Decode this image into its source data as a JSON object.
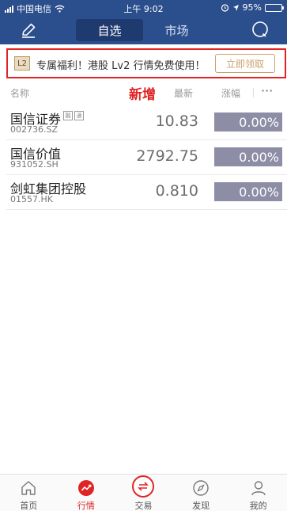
{
  "status_bar": {
    "carrier": "中国电信",
    "time": "上午 9:02",
    "battery": "95%",
    "battery_level": 0.95
  },
  "nav": {
    "tabs": [
      {
        "label": "自选",
        "active": true
      },
      {
        "label": "市场",
        "active": false
      }
    ]
  },
  "banner": {
    "badge": "L2",
    "text": "专属福利！港股 Lv2 行情免费使用！",
    "button": "立即领取"
  },
  "columns": {
    "name": "名称",
    "new_marker": "新增",
    "latest": "最新",
    "change": "涨幅",
    "more": "···"
  },
  "stocks": [
    {
      "name": "国信证券",
      "code": "002736.SZ",
      "price": "10.83",
      "change": "0.00%",
      "tags": [
        "融",
        "通"
      ]
    },
    {
      "name": "国信价值",
      "code": "931052.SH",
      "price": "2792.75",
      "change": "0.00%",
      "tags": []
    },
    {
      "name": "剑虹集团控股",
      "code": "01557.HK",
      "price": "0.810",
      "change": "0.00%",
      "tags": []
    }
  ],
  "tabbar": [
    {
      "label": "首页",
      "icon": "home-icon",
      "active": false
    },
    {
      "label": "行情",
      "icon": "market-trend-icon",
      "active": true
    },
    {
      "label": "交易",
      "icon": "trade-exchange-icon",
      "active": false
    },
    {
      "label": "发现",
      "icon": "compass-icon",
      "active": false
    },
    {
      "label": "我的",
      "icon": "user-icon",
      "active": false
    }
  ],
  "colors": {
    "header": "#2b4e8c",
    "accent_red": "#e02424",
    "change_box": "#8e8da6",
    "claim_gold": "#c9a26a"
  }
}
